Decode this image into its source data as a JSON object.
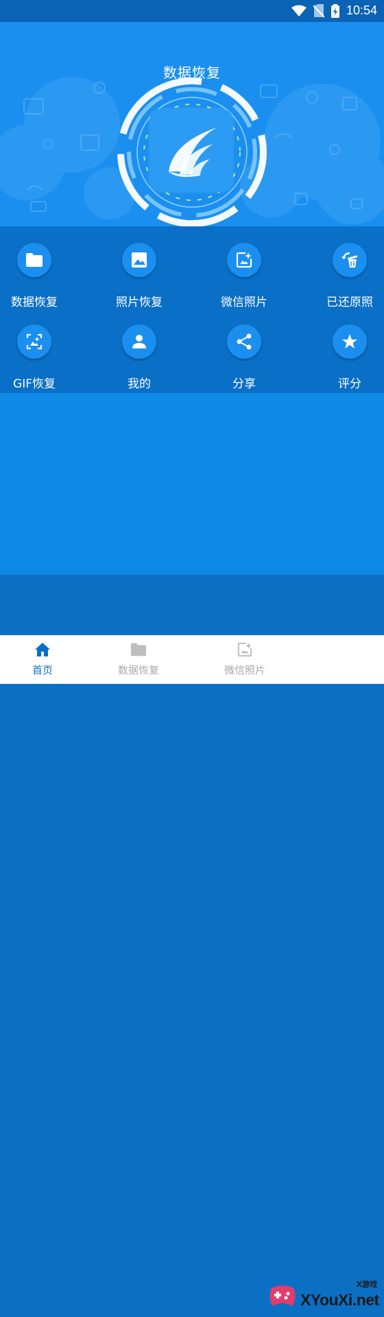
{
  "status_bar": {
    "time": "10:54"
  },
  "hero": {
    "title": "数据恢复"
  },
  "menu": [
    {
      "label": "数据恢复",
      "icon": "folder-icon"
    },
    {
      "label": "照片恢复",
      "icon": "image-icon"
    },
    {
      "label": "微信照片",
      "icon": "sparkle-photo-icon"
    },
    {
      "label": "已还原照",
      "icon": "restore-trash-icon"
    },
    {
      "label": "GIF恢复",
      "icon": "gif-image-icon"
    },
    {
      "label": "我的",
      "icon": "person-icon"
    },
    {
      "label": "分享",
      "icon": "share-icon"
    },
    {
      "label": "评分",
      "icon": "star-icon"
    }
  ],
  "bottom_nav": [
    {
      "label": "首页",
      "icon": "home-icon",
      "active": true
    },
    {
      "label": "数据恢复",
      "icon": "folder-icon",
      "active": false
    },
    {
      "label": "微信照片",
      "icon": "sparkle-photo-icon",
      "active": false
    }
  ],
  "watermark": {
    "brand": "XYouXi.net",
    "small": "X游戏"
  },
  "colors": {
    "primary": "#1a8ff0",
    "dark": "#0b6fc4",
    "active_nav": "#0a6fc6",
    "inactive_nav": "#bdbdbd"
  }
}
